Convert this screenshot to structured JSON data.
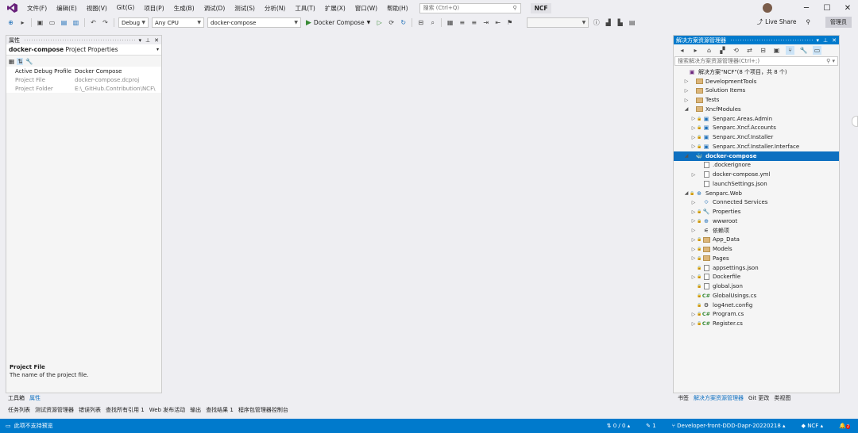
{
  "menu": {
    "items": [
      "文件(F)",
      "编辑(E)",
      "视图(V)",
      "Git(G)",
      "项目(P)",
      "生成(B)",
      "调试(D)",
      "测试(S)",
      "分析(N)",
      "工具(T)",
      "扩展(X)",
      "窗口(W)",
      "帮助(H)"
    ],
    "search_placeholder": "搜索 (Ctrl+Q)",
    "solution_badge": "NCF"
  },
  "toolbar": {
    "config": "Debug",
    "platform": "Any CPU",
    "startup": "docker-compose",
    "run_label": "Docker Compose",
    "live_share": "Live Share",
    "admin": "管理员"
  },
  "properties": {
    "title": "属性",
    "object_name": "docker-compose",
    "object_type": "Project Properties",
    "rows": [
      {
        "key": "Active Debug Profile",
        "value": "Docker Compose"
      },
      {
        "key": "Project File",
        "value": "docker-compose.dcproj"
      },
      {
        "key": "Project Folder",
        "value": "E:\\_GitHub.Contribution\\NCF\\"
      }
    ],
    "desc_title": "Project File",
    "desc_text": "The name of the project file.",
    "tabs": [
      "工具箱",
      "属性"
    ]
  },
  "lower_tabs": [
    "任务列表",
    "测试资源管理器",
    "错误列表",
    "查找所有引用 1",
    "Web 发布活动",
    "输出",
    "查找结果 1",
    "程序包管理器控制台"
  ],
  "solution": {
    "title": "解决方案资源管理器",
    "search_placeholder": "搜索解决方案资源管理器(Ctrl+;)",
    "nodes": [
      {
        "label": "解决方案\"NCF\"(8 个项目，共 8 个)",
        "indent": 0,
        "exp": "",
        "icon": "solution-icon",
        "lock": false
      },
      {
        "label": "DevelopmentTools",
        "indent": 1,
        "exp": "▷",
        "icon": "folder-icon",
        "lock": false
      },
      {
        "label": "Solution Items",
        "indent": 1,
        "exp": "▷",
        "icon": "folder-icon",
        "lock": false
      },
      {
        "label": "Tests",
        "indent": 1,
        "exp": "▷",
        "icon": "folder-icon",
        "lock": false
      },
      {
        "label": "XncfModules",
        "indent": 1,
        "exp": "◢",
        "icon": "folder-icon",
        "lock": false
      },
      {
        "label": "Senparc.Areas.Admin",
        "indent": 2,
        "exp": "▷",
        "icon": "project-icon",
        "lock": true
      },
      {
        "label": "Senparc.Xncf.Accounts",
        "indent": 2,
        "exp": "▷",
        "icon": "project-icon",
        "lock": true
      },
      {
        "label": "Senparc.Xncf.Installer",
        "indent": 2,
        "exp": "▷",
        "icon": "project-icon",
        "lock": true
      },
      {
        "label": "Senparc.Xncf.Installer.Interface",
        "indent": 2,
        "exp": "▷",
        "icon": "project-icon",
        "lock": true
      },
      {
        "label": "docker-compose",
        "indent": 1,
        "exp": "◢",
        "icon": "docker-icon",
        "lock": false,
        "selected": true
      },
      {
        "label": ".dockerignore",
        "indent": 2,
        "exp": "",
        "icon": "file-icon",
        "lock": false
      },
      {
        "label": "docker-compose.yml",
        "indent": 2,
        "exp": "▷",
        "icon": "file-icon",
        "lock": false
      },
      {
        "label": "launchSettings.json",
        "indent": 2,
        "exp": "",
        "icon": "file-icon",
        "lock": false
      },
      {
        "label": "Senparc.Web",
        "indent": 1,
        "exp": "◢",
        "icon": "web-project-icon",
        "lock": true
      },
      {
        "label": "Connected Services",
        "indent": 2,
        "exp": "▷",
        "icon": "connected-icon",
        "lock": false
      },
      {
        "label": "Properties",
        "indent": 2,
        "exp": "▷",
        "icon": "wrench-icon",
        "lock": true
      },
      {
        "label": "wwwroot",
        "indent": 2,
        "exp": "▷",
        "icon": "globe-icon",
        "lock": true
      },
      {
        "label": "依赖项",
        "indent": 2,
        "exp": "▷",
        "icon": "dependency-icon",
        "lock": false
      },
      {
        "label": "App_Data",
        "indent": 2,
        "exp": "▷",
        "icon": "folder-icon",
        "lock": true
      },
      {
        "label": "Models",
        "indent": 2,
        "exp": "▷",
        "icon": "folder-icon",
        "lock": true
      },
      {
        "label": "Pages",
        "indent": 2,
        "exp": "▷",
        "icon": "folder-icon",
        "lock": true
      },
      {
        "label": "appsettings.json",
        "indent": 2,
        "exp": "",
        "icon": "file-icon",
        "lock": true
      },
      {
        "label": "Dockerfile",
        "indent": 2,
        "exp": "▷",
        "icon": "file-icon",
        "lock": true
      },
      {
        "label": "global.json",
        "indent": 2,
        "exp": "",
        "icon": "file-icon",
        "lock": true
      },
      {
        "label": "GlobalUsings.cs",
        "indent": 2,
        "exp": "",
        "icon": "csharp-icon",
        "lock": true
      },
      {
        "label": "log4net.config",
        "indent": 2,
        "exp": "",
        "icon": "config-icon",
        "lock": true
      },
      {
        "label": "Program.cs",
        "indent": 2,
        "exp": "▷",
        "icon": "csharp-icon",
        "lock": true
      },
      {
        "label": "Register.cs",
        "indent": 2,
        "exp": "▷",
        "icon": "csharp-icon",
        "lock": true
      }
    ],
    "tabs": [
      "书签",
      "解决方案资源管理器",
      "Git 更改",
      "类视图"
    ]
  },
  "status": {
    "left": "此项不支持预览",
    "changes": "0 / 0",
    "commits": "1",
    "branch": "Developer-front-DDD-Dapr-20220218",
    "repo": "NCF",
    "notifications": "2"
  },
  "colors": {
    "accent": "#007acc",
    "selection": "#0e70c0"
  }
}
